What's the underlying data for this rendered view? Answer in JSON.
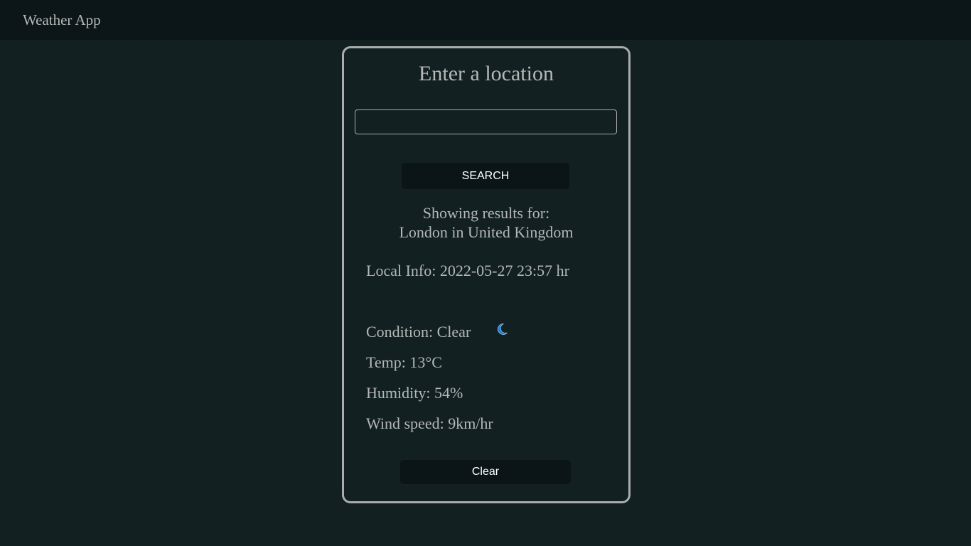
{
  "header": {
    "title": "Weather App"
  },
  "card": {
    "heading": "Enter a location",
    "search": {
      "value": "",
      "placeholder": ""
    },
    "search_button_label": "SEARCH",
    "results_label": "Showing results for:",
    "results_place": "London in United Kingdom",
    "local_info": "Local Info: 2022-05-27 23:57 hr",
    "condition": "Condition: Clear",
    "condition_icon": "crescent-moon-icon",
    "temp": "Temp: 13°C",
    "humidity": "Humidity: 54%",
    "wind_speed": "Wind speed: 9km/hr",
    "clear_button_label": "Clear"
  },
  "colors": {
    "background": "#122022",
    "topbar": "#0c1517",
    "card_border": "#a9adab",
    "button_bg": "#0b1517",
    "moon_icon": "#1e7fd0"
  }
}
